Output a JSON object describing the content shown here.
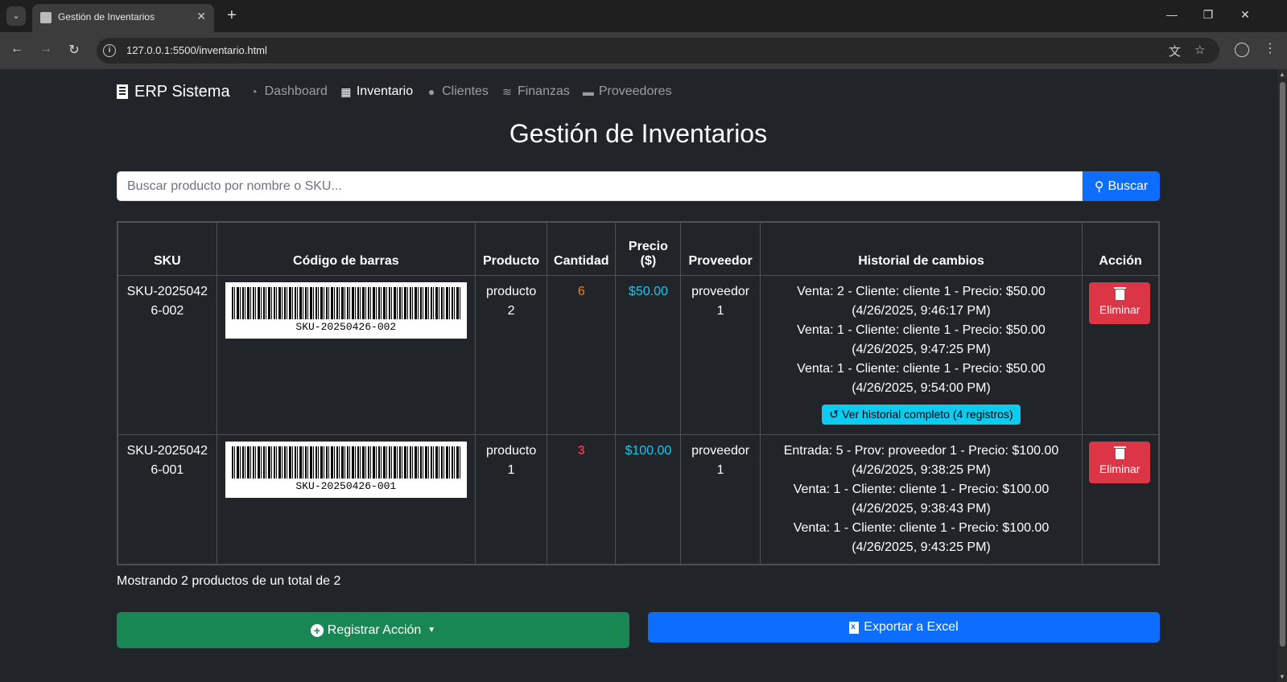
{
  "browser": {
    "tab_title": "Gestión de Inventarios",
    "url": "127.0.0.1:5500/inventario.html"
  },
  "navbar": {
    "brand": "ERP Sistema",
    "items": [
      {
        "label": "Dashboard",
        "icon": "gauge-icon",
        "active": false
      },
      {
        "label": "Inventario",
        "icon": "boxes-icon",
        "active": true
      },
      {
        "label": "Clientes",
        "icon": "users-icon",
        "active": false
      },
      {
        "label": "Finanzas",
        "icon": "coins-icon",
        "active": false
      },
      {
        "label": "Proveedores",
        "icon": "truck-icon",
        "active": false
      }
    ]
  },
  "page_title": "Gestión de Inventarios",
  "search": {
    "placeholder": "Buscar producto por nombre o SKU...",
    "button_label": "Buscar"
  },
  "table": {
    "headers": {
      "sku": "SKU",
      "barcode": "Código de barras",
      "product": "Producto",
      "quantity": "Cantidad",
      "price": "Precio ($)",
      "supplier": "Proveedor",
      "history": "Historial de cambios",
      "action": "Acción"
    },
    "rows": [
      {
        "sku": "SKU-20250426-002",
        "barcode_text": "SKU-20250426-002",
        "product": "producto 2",
        "quantity": "6",
        "price": "$50.00",
        "supplier": "proveedor 1",
        "history": [
          "Venta: 2 - Cliente: cliente 1 - Precio: $50.00 (4/26/2025, 9:46:17 PM)",
          "Venta: 1 - Cliente: cliente 1 - Precio: $50.00 (4/26/2025, 9:47:25 PM)",
          "Venta: 1 - Cliente: cliente 1 - Precio: $50.00 (4/26/2025, 9:54:00 PM)"
        ],
        "history_button": "Ver historial completo (4 registros)",
        "delete_label": "Eliminar"
      },
      {
        "sku": "SKU-20250426-001",
        "barcode_text": "SKU-20250426-001",
        "product": "producto 1",
        "quantity": "3",
        "price": "$100.00",
        "supplier": "proveedor 1",
        "history": [
          "Entrada: 5 - Prov: proveedor 1 - Precio: $100.00 (4/26/2025, 9:38:25 PM)",
          "Venta: 1 - Cliente: cliente 1 - Precio: $100.00 (4/26/2025, 9:38:43 PM)",
          "Venta: 1 - Cliente: cliente 1 - Precio: $100.00 (4/26/2025, 9:43:25 PM)"
        ],
        "delete_label": "Eliminar"
      }
    ]
  },
  "summary": "Mostrando 2 productos de un total de 2",
  "buttons": {
    "register": "Registrar Acción",
    "export": "Exportar a Excel"
  },
  "colors": {
    "background": "#212529",
    "primary": "#0d6efd",
    "success": "#198754",
    "danger": "#dc3545",
    "info": "#0dcaf0",
    "warning": "#fd7e14"
  }
}
